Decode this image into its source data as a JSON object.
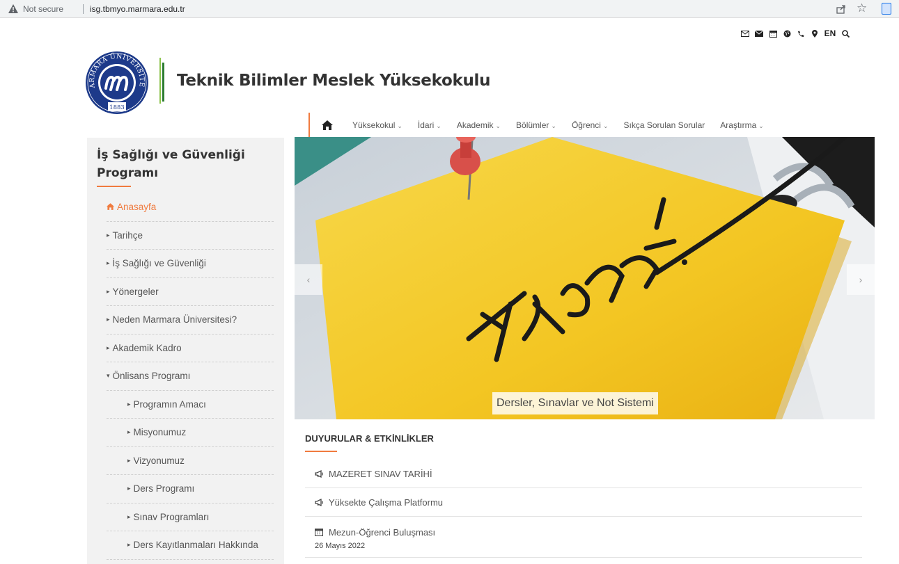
{
  "browser": {
    "security_label": "Not secure",
    "url": "isg.tbmyo.marmara.edu.tr"
  },
  "utility_icons": [
    "envelope-outline-icon",
    "envelope-icon",
    "calendar-icon",
    "globe-icon",
    "phone-icon",
    "map-marker-icon"
  ],
  "utility_lang": "EN",
  "header": {
    "site_title": "Teknik Bilimler Meslek Yüksekokulu",
    "logo_text": "MARMARA ÜNİVERSİTESİ",
    "logo_year": "1883"
  },
  "nav": {
    "items": [
      {
        "label": "Yüksekokul",
        "dropdown": true
      },
      {
        "label": "İdari",
        "dropdown": true
      },
      {
        "label": "Akademik",
        "dropdown": true
      },
      {
        "label": "Bölümler",
        "dropdown": true
      },
      {
        "label": "Öğrenci",
        "dropdown": true
      },
      {
        "label": "Sıkça Sorulan Sorular",
        "dropdown": false
      },
      {
        "label": "Araştırma",
        "dropdown": true
      }
    ],
    "chevron": "⌄"
  },
  "sidebar": {
    "title": "İş Sağlığı ve Güvenliği Programı",
    "items": [
      {
        "label": "Anasayfa",
        "marker": "home",
        "active": true
      },
      {
        "label": "Tarihçe",
        "marker": "▸"
      },
      {
        "label": "İş Sağlığı ve Güvenliği",
        "marker": "▸"
      },
      {
        "label": "Yönergeler",
        "marker": "▸"
      },
      {
        "label": "Neden Marmara Üniversitesi?",
        "marker": "▸"
      },
      {
        "label": "Akademik Kadro",
        "marker": "▸"
      },
      {
        "label": "Önlisans Programı",
        "marker": "▾"
      },
      {
        "label": "Programın Amacı",
        "marker": "▸",
        "sub": true
      },
      {
        "label": "Misyonumuz",
        "marker": "▸",
        "sub": true
      },
      {
        "label": "Vizyonumuz",
        "marker": "▸",
        "sub": true
      },
      {
        "label": "Ders Programı",
        "marker": "▸",
        "sub": true
      },
      {
        "label": "Sınav Programları",
        "marker": "▸",
        "sub": true
      },
      {
        "label": "Ders Kayıtlanmaları Hakkında",
        "marker": "▸",
        "sub": true
      }
    ]
  },
  "slider": {
    "caption": "Dersler, Sınavlar ve Not Sistemi",
    "image_text": "Exam!",
    "prev": "‹",
    "next": "›"
  },
  "announcements": {
    "title": "DUYURULAR & ETKİNLİKLER",
    "items": [
      {
        "label": "MAZERET SINAV TARİHİ",
        "icon": "bullhorn-icon"
      },
      {
        "label": "Yüksekte Çalışma Platformu",
        "icon": "bullhorn-icon"
      },
      {
        "label": "Mezun-Öğrenci Buluşması",
        "icon": "calendar-icon",
        "date": "26 Mayıs 2022"
      }
    ]
  },
  "colors": {
    "accent": "#f07b3f",
    "sidebar_bg": "#f2f2f2",
    "green_bar": "#2e7d32",
    "logo_blue": "#1d3a8a"
  }
}
